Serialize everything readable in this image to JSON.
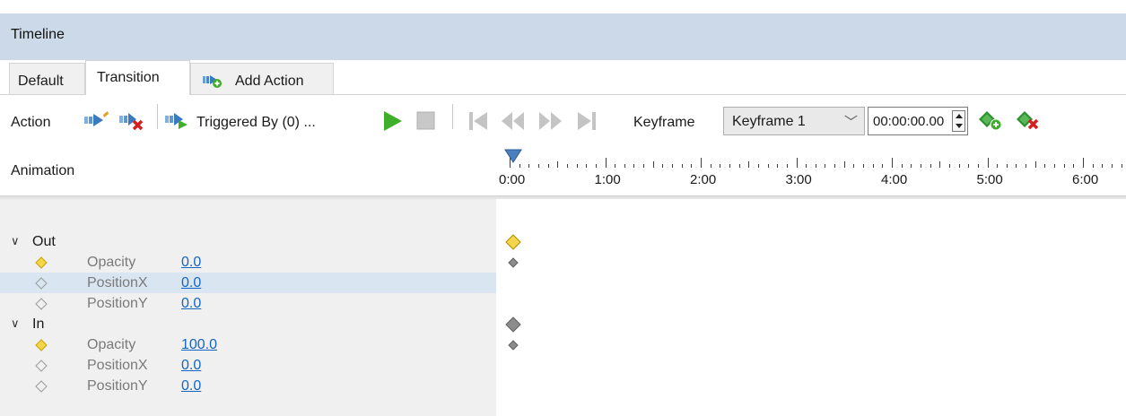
{
  "panel": {
    "title": "Timeline"
  },
  "tabs": [
    {
      "label": "Default",
      "active": false
    },
    {
      "label": "Transition",
      "active": true
    },
    {
      "label": "Add Action",
      "icon": "add-action-icon",
      "active": false
    }
  ],
  "toolbar": {
    "action_label": "Action",
    "triggered_label": "Triggered By (0) ...",
    "keyframe_label": "Keyframe",
    "keyframe_selected": "Keyframe 1",
    "time_value": "00:00:00.00"
  },
  "timeline": {
    "header_label": "Animation",
    "ruler_labels": [
      "0:00",
      "1:00",
      "2:00",
      "3:00",
      "4:00",
      "5:00",
      "6:00"
    ]
  },
  "groups": [
    {
      "name": "Out",
      "properties": [
        {
          "name": "Opacity",
          "value": "0.0",
          "keyed": true
        },
        {
          "name": "PositionX",
          "value": "0.0",
          "keyed": false,
          "selected": true
        },
        {
          "name": "PositionY",
          "value": "0.0",
          "keyed": false
        }
      ]
    },
    {
      "name": "In",
      "properties": [
        {
          "name": "Opacity",
          "value": "100.0",
          "keyed": true
        },
        {
          "name": "PositionX",
          "value": "0.0",
          "keyed": false
        },
        {
          "name": "PositionY",
          "value": "0.0",
          "keyed": false
        }
      ]
    }
  ],
  "colors": {
    "title_bar": "#cbd9e8",
    "selected_row": "#d9e6f2",
    "key_yellow": "#f5d54a",
    "key_gray": "#8c8c8c",
    "play_green": "#3fae2a",
    "link_blue": "#1565c0"
  }
}
